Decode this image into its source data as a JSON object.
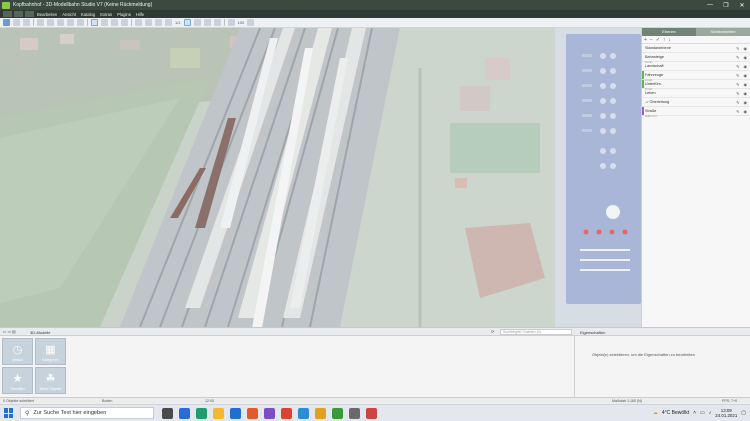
{
  "window": {
    "title": "Kopfbahnhof - 3D-Modellbahn Studio V7 (Keine Rückmeldung)",
    "controls": [
      "—",
      "❐",
      "✕"
    ]
  },
  "menu": [
    "Bearbeiten",
    "Ansicht",
    "Katalog",
    "Extras",
    "Plugins",
    "Hilfe"
  ],
  "toolbar": {
    "value_a": "1/1",
    "value_b": "100"
  },
  "layers_panel": {
    "tabs": [
      "Ebenen",
      "Sichtbarkeiten"
    ],
    "items": [
      {
        "name": "Standardebene",
        "sub": "",
        "color": ""
      },
      {
        "name": "Bahnsteige",
        "sub": "0 min",
        "color": ""
      },
      {
        "name": "Landschaft",
        "sub": "",
        "color": ""
      },
      {
        "name": "Fahrzeuge",
        "sub": "0 min",
        "color": "#5bb84a"
      },
      {
        "name": "Unterführ.",
        "sub": "0 min",
        "color": "#5bb84a"
      },
      {
        "name": "Leben",
        "sub": "",
        "color": ""
      },
      {
        "name": "-> Oberleitung",
        "sub": "",
        "color": ""
      },
      {
        "name": "Straße",
        "sub": "0,00 min",
        "color": "#a060c0"
      }
    ]
  },
  "bottom": {
    "catalog_label": "3D-Modelle",
    "search_placeholder": "Suchbegriff / Dateien (0)",
    "properties_label": "Eigenschaften",
    "properties_msg": "Objekt(e) selektieren, um die Eigenschaften zu bearbeiten",
    "tiles": [
      {
        "label": "Verlauf",
        "symbol": "◷"
      },
      {
        "label": "Kategorien",
        "symbol": "▦"
      },
      {
        "label": "Favoriten",
        "symbol": "★"
      },
      {
        "label": "Meine Objekte",
        "symbol": "☘"
      }
    ]
  },
  "status": {
    "selection": "0 Objekte selektiert",
    "mode": "Boden",
    "time": "12:00",
    "scale": "Maßstab 1:160 (N)",
    "fps": "FPS: 7+0"
  },
  "taskbar": {
    "search_placeholder": "Zur Suche Text hier eingeben",
    "weather": "4°C Bewölkt",
    "time": "13:09",
    "date": "24.01.2021",
    "app_colors": [
      "#4a4a4a",
      "#2b6bd6",
      "#1e9e6e",
      "#f2b92e",
      "#1f6fd0",
      "#e35b2a",
      "#7c4dc4",
      "#d9432f",
      "#2c8cd8",
      "#e0a020",
      "#3a9a3a",
      "#6a6a6a",
      "#c44"
    ]
  }
}
